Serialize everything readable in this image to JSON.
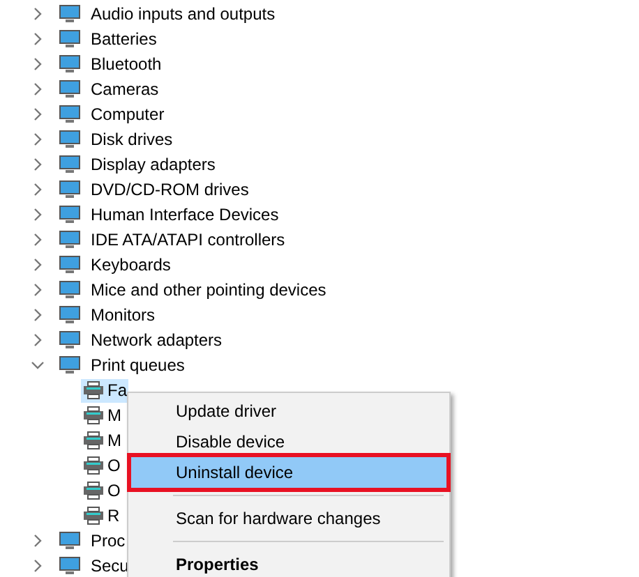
{
  "tree": [
    {
      "label": "Audio inputs and outputs",
      "expanded": false
    },
    {
      "label": "Batteries",
      "expanded": false
    },
    {
      "label": "Bluetooth",
      "expanded": false
    },
    {
      "label": "Cameras",
      "expanded": false
    },
    {
      "label": "Computer",
      "expanded": false
    },
    {
      "label": "Disk drives",
      "expanded": false
    },
    {
      "label": "Display adapters",
      "expanded": false
    },
    {
      "label": "DVD/CD-ROM drives",
      "expanded": false
    },
    {
      "label": "Human Interface Devices",
      "expanded": false
    },
    {
      "label": "IDE ATA/ATAPI controllers",
      "expanded": false
    },
    {
      "label": "Keyboards",
      "expanded": false
    },
    {
      "label": "Mice and other pointing devices",
      "expanded": false
    },
    {
      "label": "Monitors",
      "expanded": false
    },
    {
      "label": "Network adapters",
      "expanded": false
    },
    {
      "label": "Print queues",
      "expanded": true,
      "children": [
        {
          "label": "Fa",
          "selected": true
        },
        {
          "label": "M",
          "selected": false
        },
        {
          "label": "M",
          "selected": false
        },
        {
          "label": "O",
          "selected": false
        },
        {
          "label": "O",
          "selected": false
        },
        {
          "label": "R",
          "selected": false
        }
      ]
    },
    {
      "label": "Proc",
      "expanded": false
    },
    {
      "label": "Secu",
      "expanded": false
    }
  ],
  "context_menu": [
    {
      "kind": "item",
      "label": "Update driver",
      "selected": false,
      "outlined": false,
      "bold": false
    },
    {
      "kind": "item",
      "label": "Disable device",
      "selected": false,
      "outlined": false,
      "bold": false
    },
    {
      "kind": "item",
      "label": "Uninstall device",
      "selected": true,
      "outlined": true,
      "bold": false
    },
    {
      "kind": "separator"
    },
    {
      "kind": "item",
      "label": "Scan for hardware changes",
      "selected": false,
      "outlined": false,
      "bold": false
    },
    {
      "kind": "separator"
    },
    {
      "kind": "item",
      "label": "Properties",
      "selected": false,
      "outlined": false,
      "bold": true
    }
  ]
}
